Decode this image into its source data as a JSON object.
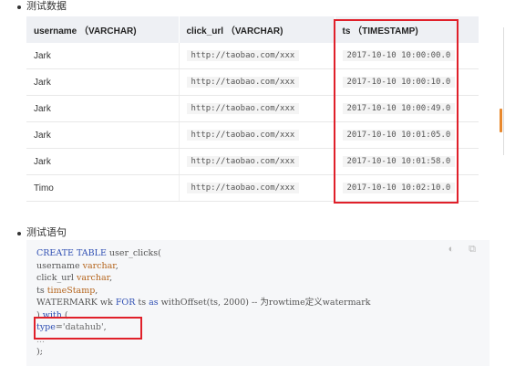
{
  "section1": {
    "title": "测试数据"
  },
  "table": {
    "headers": [
      "username （VARCHAR)",
      "click_url （VARCHAR)",
      "ts （TIMESTAMP)"
    ],
    "rows": [
      [
        "Jark",
        "http://taobao.com/xxx",
        "2017-10-10 10:00:00.0"
      ],
      [
        "Jark",
        "http://taobao.com/xxx",
        "2017-10-10 10:00:10.0"
      ],
      [
        "Jark",
        "http://taobao.com/xxx",
        "2017-10-10 10:00:49.0"
      ],
      [
        "Jark",
        "http://taobao.com/xxx",
        "2017-10-10 10:01:05.0"
      ],
      [
        "Jark",
        "http://taobao.com/xxx",
        "2017-10-10 10:01:58.0"
      ],
      [
        "Timo",
        "http://taobao.com/xxx",
        "2017-10-10 10:02:10.0"
      ]
    ]
  },
  "section2": {
    "title": "测试语句"
  },
  "code": {
    "l1_kw": "CREATE TABLE",
    "l1_rest": " user_clicks(",
    "l2_name": "username ",
    "l2_type": "varchar",
    "l2_end": ",",
    "l3_name": "click_url ",
    "l3_type": "varchar",
    "l3_end": ",",
    "l4_name": "ts ",
    "l4_type": "timeStamp",
    "l4_end": ",",
    "l5_a": "WATERMARK wk ",
    "l5_for": "FOR",
    "l5_b": " ts ",
    "l5_as": "as",
    "l5_c": " withOffset(ts, 2000) -- 为rowtime定义watermark",
    "l6_a": ") ",
    "l6_with": "with",
    "l6_b": " (",
    "l7_key": "type",
    "l7_eq": "=",
    "l7_val": "'datahub'",
    "l7_end": ",",
    "l8": "...",
    "l9": ");"
  },
  "icons": {
    "copy": "copy-icon",
    "toggle": "toggle-icon"
  },
  "colors": {
    "highlight_border": "#e0202a",
    "header_bg": "#eef0f4",
    "keyword": "#2f4fb3",
    "type": "#b5651d",
    "scroll_thumb": "#e8882d"
  }
}
